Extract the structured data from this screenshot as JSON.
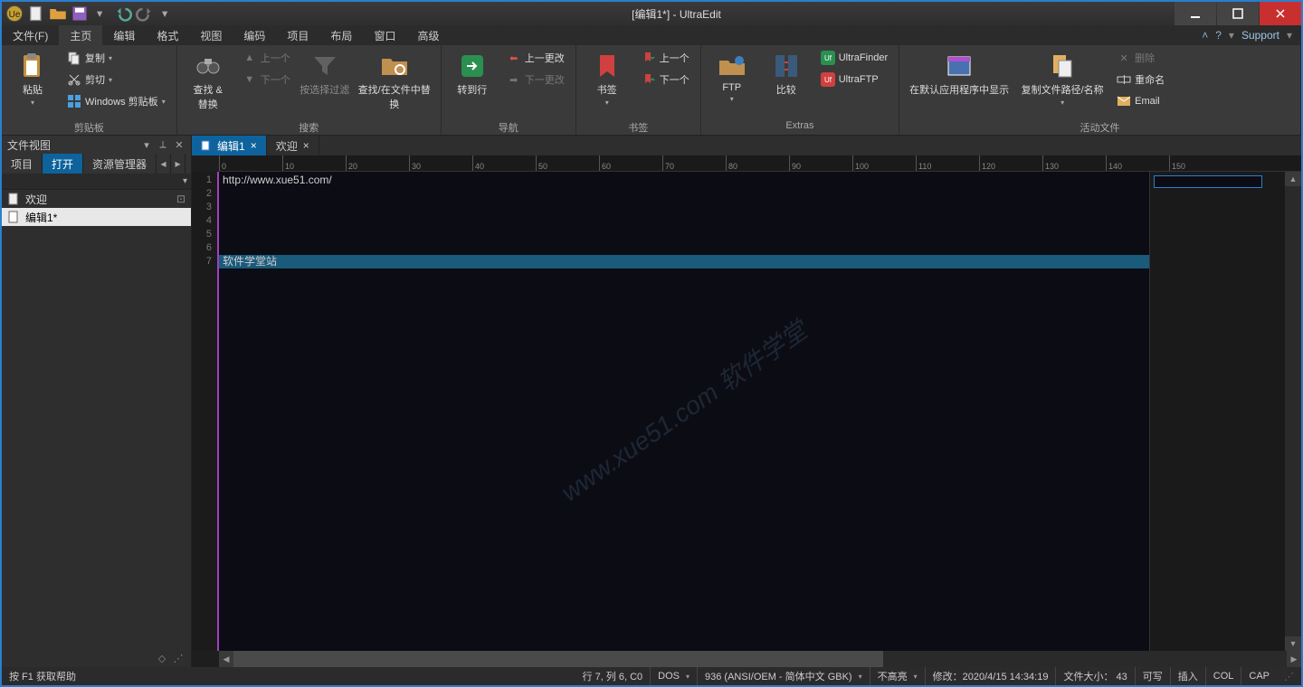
{
  "title": "[编辑1*] - UltraEdit",
  "menubar": {
    "tabs": [
      "文件(F)",
      "主页",
      "编辑",
      "格式",
      "视图",
      "编码",
      "项目",
      "布局",
      "窗口",
      "高级"
    ],
    "active": 1,
    "support": "Support"
  },
  "ribbon": {
    "groups": {
      "clipboard": {
        "label": "剪贴板",
        "paste": "粘贴",
        "copy": "复制",
        "cut": "剪切",
        "winclip": "Windows 剪贴板"
      },
      "search": {
        "label": "搜索",
        "findrepl": "查找 &\n替换",
        "prev": "上一个",
        "next": "下一个",
        "bysel": "按选择过滤",
        "findinfiles": "查找/在文件中替换"
      },
      "nav": {
        "label": "导航",
        "goto": "转到行",
        "lastchange": "上一更改",
        "nextchange": "下一更改"
      },
      "bookmark": {
        "label": "书签",
        "bm": "书签",
        "prev": "上一个",
        "next": "下一个"
      },
      "extras": {
        "label": "Extras",
        "ftp": "FTP",
        "compare": "比较",
        "uf": "UltraFinder",
        "uftp": "UltraFTP"
      },
      "activefile": {
        "label": "活动文件",
        "openindefault": "在默认应用程序中显示",
        "copypath": "复制文件路径/名称",
        "delete": "删除",
        "rename": "重命名",
        "email": "Email"
      }
    }
  },
  "leftpanel": {
    "title": "文件视图",
    "tabs": [
      "项目",
      "打开",
      "资源管理器"
    ],
    "active": 1,
    "items": [
      {
        "label": "欢迎",
        "sel": false
      },
      {
        "label": "编辑1*",
        "sel": true
      }
    ]
  },
  "doctabs": {
    "tabs": [
      {
        "label": "编辑1",
        "active": true
      },
      {
        "label": "欢迎",
        "active": false
      }
    ]
  },
  "editor": {
    "lines": [
      "http://www.xue51.com/",
      "",
      "",
      "",
      "",
      "",
      "软件学堂站"
    ],
    "highlight": 7
  },
  "watermark": "www.xue51.com 软件学堂",
  "statusbar": {
    "help": "按 F1 获取帮助",
    "pos": "行 7, 列 6, C0",
    "eol": "DOS",
    "enc": "936  (ANSI/OEM - 简体中文 GBK)",
    "hl": "不高亮",
    "mod": "修改：2020/4/15 14:34:19",
    "size": "文件大小： 43",
    "rw": "可写",
    "ins": "插入",
    "col": "COL",
    "cap": "CAP"
  }
}
